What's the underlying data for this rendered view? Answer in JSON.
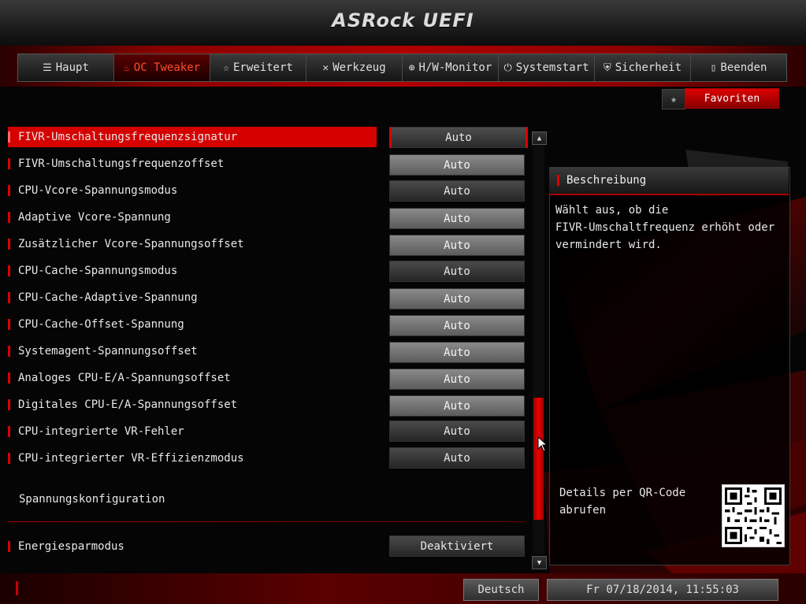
{
  "header": {
    "brand": "ASRock UEFI"
  },
  "tabs": [
    {
      "label": "Haupt",
      "icon": "list-icon",
      "active": false
    },
    {
      "label": "OC Tweaker",
      "icon": "flame-icon",
      "active": true
    },
    {
      "label": "Erweitert",
      "icon": "star-icon",
      "active": false
    },
    {
      "label": "Werkzeug",
      "icon": "tools-icon",
      "active": false
    },
    {
      "label": "H/W-Monitor",
      "icon": "monitor-icon",
      "active": false
    },
    {
      "label": "Systemstart",
      "icon": "power-icon",
      "active": false
    },
    {
      "label": "Sicherheit",
      "icon": "shield-icon",
      "active": false
    },
    {
      "label": "Beenden",
      "icon": "exit-icon",
      "active": false
    }
  ],
  "favorites": {
    "label": "Favoriten",
    "icon": "star-icon"
  },
  "settings": [
    {
      "label": "FIVR-Umschaltungsfrequenzsignatur",
      "value": "Auto",
      "style": "selected"
    },
    {
      "label": "FIVR-Umschaltungsfrequenzoffset",
      "value": "Auto",
      "style": "light"
    },
    {
      "label": "CPU-Vcore-Spannungsmodus",
      "value": "Auto",
      "style": "dark"
    },
    {
      "label": "Adaptive Vcore-Spannung",
      "value": "Auto",
      "style": "light"
    },
    {
      "label": "Zusätzlicher Vcore-Spannungsoffset",
      "value": "Auto",
      "style": "light"
    },
    {
      "label": "CPU-Cache-Spannungsmodus",
      "value": "Auto",
      "style": "dark"
    },
    {
      "label": "CPU-Cache-Adaptive-Spannung",
      "value": "Auto",
      "style": "light"
    },
    {
      "label": "CPU-Cache-Offset-Spannung",
      "value": "Auto",
      "style": "light"
    },
    {
      "label": "Systemagent-Spannungsoffset",
      "value": "Auto",
      "style": "light"
    },
    {
      "label": "Analoges CPU-E/A-Spannungsoffset",
      "value": "Auto",
      "style": "light"
    },
    {
      "label": "Digitales CPU-E/A-Spannungsoffset",
      "value": "Auto",
      "style": "light"
    },
    {
      "label": "CPU-integrierte VR-Fehler",
      "value": "Auto",
      "style": "dark"
    },
    {
      "label": "CPU-integrierter VR-Effizienzmodus",
      "value": "Auto",
      "style": "dark"
    }
  ],
  "section_label": "Spannungskonfiguration",
  "energy": {
    "label": "Energiesparmodus",
    "value": "Deaktiviert"
  },
  "description": {
    "title": "Beschreibung",
    "text": "Wählt aus, ob die\nFIVR-Umschaltfrequenz erhöht oder\nvermindert wird.",
    "qr_label": "Details per QR-Code\nabrufen"
  },
  "footer": {
    "language": "Deutsch",
    "datetime": "Fr 07/18/2014, 11:55:03"
  },
  "colors": {
    "accent": "#d50000",
    "background": "#050505"
  }
}
